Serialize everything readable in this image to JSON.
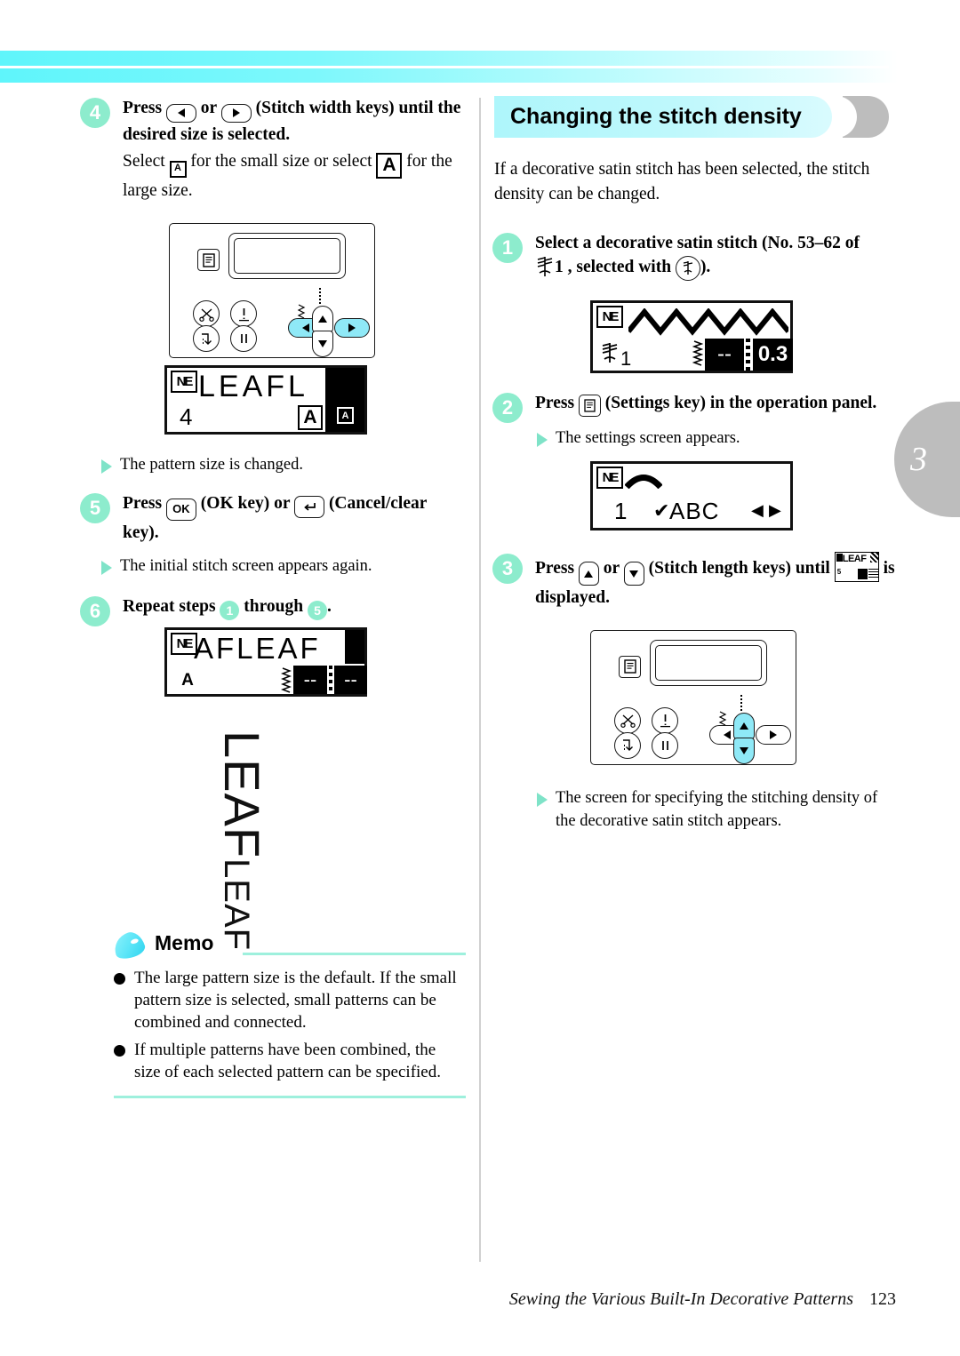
{
  "chapter_tab": {
    "number": "3"
  },
  "left_column": {
    "step4": {
      "badge": "4",
      "heading_prefix": "Press",
      "heading_key_left": "left-arrow",
      "heading_or": "or",
      "heading_key_right": "right-arrow",
      "heading_suffix": "(Stitch width keys) until the desired size is selected.",
      "body_prefix": "Select",
      "glyph_small": "A",
      "body_middle": "for the small size or select",
      "glyph_large": "A",
      "body_suffix": "for the large size."
    },
    "panel1": {
      "settings_key": "settings-icon",
      "btn_scissors": "scissors-icon",
      "btn_needle_position": "needle-position-icon",
      "btn_reverse": "reverse-stitch-icon",
      "btn_reinforcement": "reinforcement-stitch-icon",
      "left_arrow_highlighted": true,
      "right_arrow_highlighted": true,
      "up_arrow_highlighted": false,
      "down_arrow_highlighted": false
    },
    "lcd1": {
      "badge": "NE",
      "top_text": "LEAFL",
      "number": "4",
      "glyph_large": "A",
      "glyph_small": "A"
    },
    "result1": "The pattern size is changed.",
    "step5": {
      "badge": "5",
      "prefix": "Press",
      "key_ok": "OK",
      "mid1": "(OK key) or",
      "key_cancel": "cancel-clear-icon",
      "mid2": "(Cancel/clear key)."
    },
    "result2": "The initial stitch screen appears again.",
    "step6": {
      "badge": "6",
      "text_prefix": "Repeat steps",
      "from": "1",
      "text_mid": "through",
      "to": "5",
      "text_suffix": "."
    },
    "lcd2": {
      "badge": "NE",
      "top_text": "AFLEAF",
      "glyph_large": "A",
      "value_left": "--",
      "value_right": "--"
    },
    "sample": {
      "line_big": "LEAF",
      "line_small": "LEAF"
    },
    "memo": {
      "title": "Memo",
      "items": [
        "The large pattern size is the default. If the small pattern size is selected, small patterns can be combined and connected.",
        "If multiple patterns have been combined, the size of each selected pattern can be specified."
      ]
    }
  },
  "right_column": {
    "section_title": "Changing the stitch density",
    "intro": "If a decorative satin stitch has been selected, the stitch density can be changed.",
    "step1": {
      "badge": "1",
      "line1": "Select a decorative satin stitch (No. 53–62 of",
      "stitch_group": "1",
      "line2_mid": ", selected with",
      "key_icon": "decorative-stitch-icon",
      "line2_end": ")."
    },
    "lcd1": {
      "badge": "NE",
      "pattern": "zigzag",
      "group_label": "1",
      "value_dash": "--",
      "value": "0.3"
    },
    "step2": {
      "badge": "2",
      "prefix": "Press",
      "key_icon": "settings-icon",
      "suffix": "(Settings key) in the operation panel."
    },
    "result1": "The settings screen appears.",
    "lcd2": {
      "badge": "NE",
      "number": "1",
      "check": "✔",
      "label": "ABC",
      "arrow_left": "◀",
      "arrow_right": "▶"
    },
    "step3": {
      "badge": "3",
      "prefix": "Press",
      "key_up": "up-arrow",
      "or": "or",
      "key_down": "down-arrow",
      "mid": "(Stitch length keys) until",
      "mini_lcd_text": "LEAF",
      "suffix": "is displayed."
    },
    "panel2": {
      "settings_key": "settings-icon",
      "left_arrow_highlighted": false,
      "right_arrow_highlighted": false,
      "up_arrow_highlighted": true,
      "down_arrow_highlighted": true
    },
    "result2": "The screen for specifying the stitching density of the decorative satin stitch appears."
  },
  "footer": {
    "title": "Sewing the Various Built-In Decorative Patterns",
    "page": "123"
  },
  "colors": {
    "accent_cyan": "#8feff7",
    "badge_green": "#8deccd",
    "tab_gray": "#bdbdbd",
    "memo_rule": "#9ef0dd"
  }
}
